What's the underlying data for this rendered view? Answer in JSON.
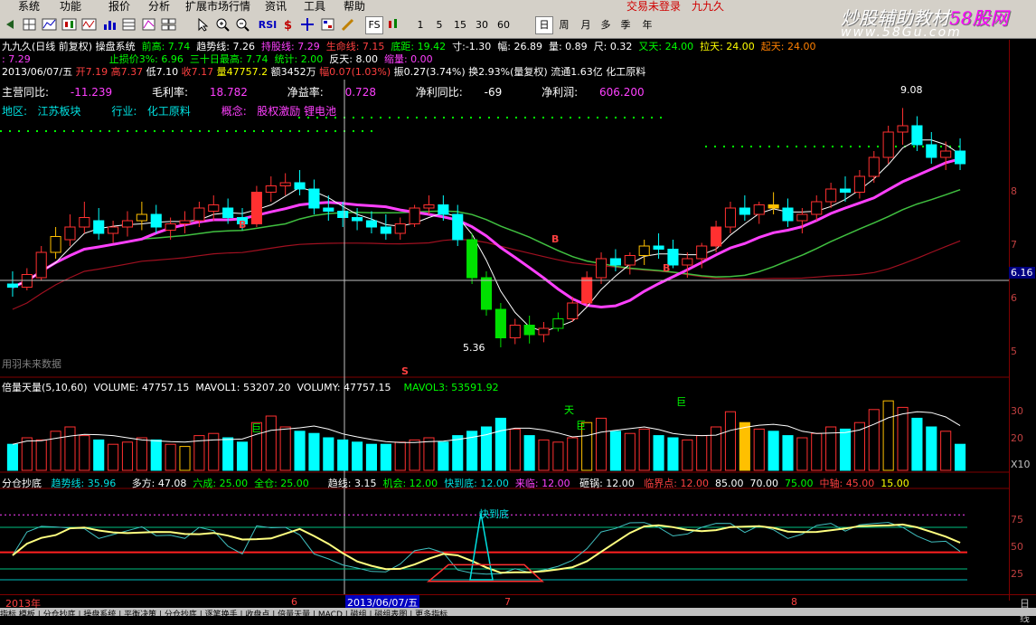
{
  "menu": {
    "items": [
      "系统",
      "功能",
      "报价",
      "分析",
      "扩展市场行情",
      "资讯",
      "工具",
      "帮助"
    ],
    "trade_login": "交易未登录",
    "app_name": "九九久"
  },
  "toolbar": {
    "rsi_label": "RSI",
    "fs_label": "FS",
    "periods": [
      "1",
      "5",
      "15",
      "30",
      "60",
      "日",
      "周",
      "月",
      "多",
      "季",
      "年"
    ],
    "selected_period": "日"
  },
  "watermark": {
    "text_a": "炒股辅助教材",
    "text_b": "58股网",
    "url": "www.58Gu.com"
  },
  "info_line1": {
    "title": "九九久(日线 前复权)",
    "system": "操盘系统",
    "qiangao_label": "前高: 7.74",
    "qushixian_label": "趋势线: 7.26",
    "chigu_label": "持股线: 7.29",
    "shenming_label": "生命线: 7.15",
    "diju_label": "底距: 19.42",
    "cun_label": "寸:-1.30",
    "fu_label": "幅: 26.89",
    "liang_label": "量: 0.89",
    "chi_label": "尺: 0.32",
    "wutian_label": "又天: 24.00",
    "latian_label": "拉天: 24.00",
    "qitian_label": "起天: 24.00"
  },
  "info_line2": {
    "v1": ": 7.29",
    "zhisun": "止损价3%: 6.96",
    "sanshi": "三十日最高: 7.74",
    "tongji": "统计: 2.00",
    "fantian": "反天: 8.00",
    "extra": "缩量: 0.00"
  },
  "info_line3": {
    "date": "2013/06/07/五",
    "open": "开7.19",
    "high": "高7.37",
    "low": "低7.10",
    "close": "收7.17",
    "vol": "量47757.2",
    "amount": "额3452万",
    "change": "幅0.07(1.03%)",
    "amp": "振0.27(3.74%)",
    "turnover": "换2.93%(量复权)",
    "float": "流通1.63亿",
    "industry": "化工原料"
  },
  "fundamentals": {
    "zhuying_label": "主营同比:",
    "zhuying_value": "-11.239",
    "maoli_label": "毛利率:",
    "maoli_value": "18.782",
    "jingyi_label": "净益率:",
    "jingyi_value": "0.728",
    "jinglitongbi_label": "净利同比:",
    "jinglitongbi_value": "-69",
    "jingli_label": "净利润:",
    "jingli_value": "606.200",
    "diqu_label": "地区:",
    "diqu_value": "江苏板块",
    "hangye_label": "行业:",
    "hangye_value": "化工原料",
    "gainian_label": "概念:",
    "gainian_value": "股权激励 锂电池"
  },
  "price_chart": {
    "high_note": "9.08",
    "low_note": "5.36",
    "cursor_price": "6.16",
    "cn_watermark": "用羽未来数据",
    "buy_letter": "B",
    "sell_letter": "S",
    "y_labels": [
      "8",
      "7",
      "6",
      "5"
    ]
  },
  "volume_panel": {
    "title": "倍量天量(5,10,60)",
    "volume": "VOLUME: 47757.15",
    "mavol1": "MAVOL1: 53207.20",
    "volumy": "VOLUMY: 47757.15",
    "mavol3": "MAVOL3: 53591.92",
    "tag_ju": "巨",
    "tag_tian": "天",
    "y_labels": [
      "30",
      "20",
      "10"
    ],
    "unit": "X10"
  },
  "osc_panel": {
    "title": "分仓抄底",
    "qushi": "趋势线: 35.96",
    "duofang": "多方: 47.08",
    "liucheng": "六成: 25.00",
    "quancang": "全仓: 25.00",
    "qxian": "趋线: 3.15",
    "jihui": "机会: 12.00",
    "kuaidaodi": "快到底: 12.00",
    "lailin": "来临: 12.00",
    "yingguo": "砸锅: 12.00",
    "linjie": "临界点: 12.00",
    "l85": "85.00",
    "l70": "70.00",
    "l75": "75.00",
    "zhongjie": "中轴: 45.00",
    "l15": "15.00",
    "kuaidaodi_tag": "快到底",
    "y_labels": [
      "75",
      "50",
      "25"
    ]
  },
  "date_axis": {
    "labels": [
      "2013年",
      "6",
      "7",
      "8"
    ],
    "selected": "2013/06/07/五",
    "right": "日线"
  },
  "bottom_tabs": "指标 模板 | 分仓抄底 | 操盘系统 | 平衡决策 | 分仓抄底 | 逐笔换手 | 收盘点 | 倍量天量 | MACD | 磁组 | 磁组表图 | 更多指标",
  "colors": {
    "up": "#ff3030",
    "down_bar": "#00ffff",
    "green_candle": "#00e000",
    "pink_line": "#ff40ff",
    "axis": "#800000",
    "yellow_candle": "#ffc000"
  },
  "chart_data": {
    "type": "candlestick",
    "candles": [
      [
        6.3,
        6.5,
        6.1,
        6.25
      ],
      [
        6.25,
        6.55,
        6.2,
        6.45
      ],
      [
        6.4,
        6.9,
        6.35,
        6.8
      ],
      [
        6.8,
        7.2,
        6.7,
        7.05
      ],
      [
        7.0,
        7.4,
        6.9,
        7.2
      ],
      [
        7.2,
        7.6,
        7.1,
        7.35
      ],
      [
        7.3,
        7.5,
        7.0,
        7.1
      ],
      [
        7.1,
        7.3,
        6.95,
        7.2
      ],
      [
        7.2,
        7.45,
        7.05,
        7.3
      ],
      [
        7.3,
        7.6,
        7.15,
        7.4
      ],
      [
        7.4,
        7.55,
        7.1,
        7.2
      ],
      [
        7.15,
        7.35,
        7.0,
        7.25
      ],
      [
        7.25,
        7.45,
        7.1,
        7.3
      ],
      [
        7.3,
        7.6,
        7.2,
        7.5
      ],
      [
        7.45,
        7.7,
        7.3,
        7.55
      ],
      [
        7.5,
        7.65,
        7.25,
        7.35
      ],
      [
        7.35,
        7.5,
        7.15,
        7.25
      ],
      [
        7.25,
        7.85,
        7.2,
        7.75
      ],
      [
        7.75,
        8.0,
        7.6,
        7.85
      ],
      [
        7.85,
        8.05,
        7.7,
        7.9
      ],
      [
        7.9,
        8.1,
        7.7,
        7.8
      ],
      [
        7.8,
        7.95,
        7.4,
        7.5
      ],
      [
        7.5,
        7.7,
        7.3,
        7.45
      ],
      [
        7.45,
        7.6,
        7.2,
        7.35
      ],
      [
        7.35,
        7.5,
        7.15,
        7.3
      ],
      [
        7.3,
        7.45,
        7.1,
        7.2
      ],
      [
        7.2,
        7.4,
        7.0,
        7.1
      ],
      [
        7.1,
        7.35,
        7.0,
        7.25
      ],
      [
        7.25,
        7.55,
        7.2,
        7.5
      ],
      [
        7.5,
        7.7,
        7.4,
        7.55
      ],
      [
        7.55,
        7.7,
        7.3,
        7.4
      ],
      [
        7.4,
        7.55,
        6.9,
        7.0
      ],
      [
        7.0,
        7.1,
        6.3,
        6.4
      ],
      [
        6.4,
        6.5,
        5.8,
        5.9
      ],
      [
        5.9,
        6.0,
        5.3,
        5.45
      ],
      [
        5.45,
        5.75,
        5.35,
        5.65
      ],
      [
        5.65,
        5.8,
        5.36,
        5.5
      ],
      [
        5.5,
        5.7,
        5.38,
        5.6
      ],
      [
        5.6,
        5.85,
        5.55,
        5.75
      ],
      [
        5.75,
        6.1,
        5.7,
        6.0
      ],
      [
        6.0,
        6.5,
        5.95,
        6.4
      ],
      [
        6.4,
        6.8,
        6.3,
        6.7
      ],
      [
        6.7,
        6.85,
        6.5,
        6.6
      ],
      [
        6.6,
        6.8,
        6.45,
        6.75
      ],
      [
        6.75,
        7.0,
        6.6,
        6.9
      ],
      [
        6.9,
        7.1,
        6.7,
        6.85
      ],
      [
        6.85,
        7.0,
        6.55,
        6.6
      ],
      [
        6.6,
        6.8,
        6.4,
        6.7
      ],
      [
        6.7,
        6.95,
        6.55,
        6.9
      ],
      [
        6.9,
        7.3,
        6.8,
        7.2
      ],
      [
        7.2,
        7.6,
        7.1,
        7.5
      ],
      [
        7.5,
        7.7,
        7.3,
        7.4
      ],
      [
        7.4,
        7.6,
        7.25,
        7.55
      ],
      [
        7.55,
        7.75,
        7.4,
        7.5
      ],
      [
        7.5,
        7.65,
        7.2,
        7.3
      ],
      [
        7.3,
        7.5,
        7.1,
        7.4
      ],
      [
        7.4,
        7.7,
        7.3,
        7.6
      ],
      [
        7.6,
        7.9,
        7.5,
        7.8
      ],
      [
        7.8,
        8.0,
        7.6,
        7.75
      ],
      [
        7.75,
        8.1,
        7.65,
        8.0
      ],
      [
        8.0,
        8.4,
        7.9,
        8.3
      ],
      [
        8.3,
        8.8,
        8.2,
        8.7
      ],
      [
        8.7,
        9.08,
        8.5,
        8.8
      ],
      [
        8.8,
        8.95,
        8.4,
        8.5
      ],
      [
        8.5,
        8.7,
        8.2,
        8.3
      ],
      [
        8.3,
        8.55,
        8.1,
        8.4
      ],
      [
        8.4,
        8.6,
        8.1,
        8.2
      ]
    ],
    "volume": [
      12,
      15,
      14,
      18,
      20,
      16,
      14,
      12,
      13,
      15,
      14,
      12,
      11,
      16,
      17,
      15,
      13,
      22,
      25,
      20,
      18,
      17,
      15,
      14,
      13,
      12,
      12,
      13,
      14,
      15,
      13,
      16,
      18,
      20,
      24,
      19,
      16,
      14,
      13,
      15,
      22,
      24,
      18,
      17,
      19,
      16,
      15,
      14,
      16,
      20,
      27,
      22,
      19,
      18,
      16,
      15,
      17,
      20,
      19,
      22,
      28,
      32,
      29,
      24,
      20,
      18,
      12
    ],
    "ylim": [
      5.0,
      9.5
    ]
  }
}
